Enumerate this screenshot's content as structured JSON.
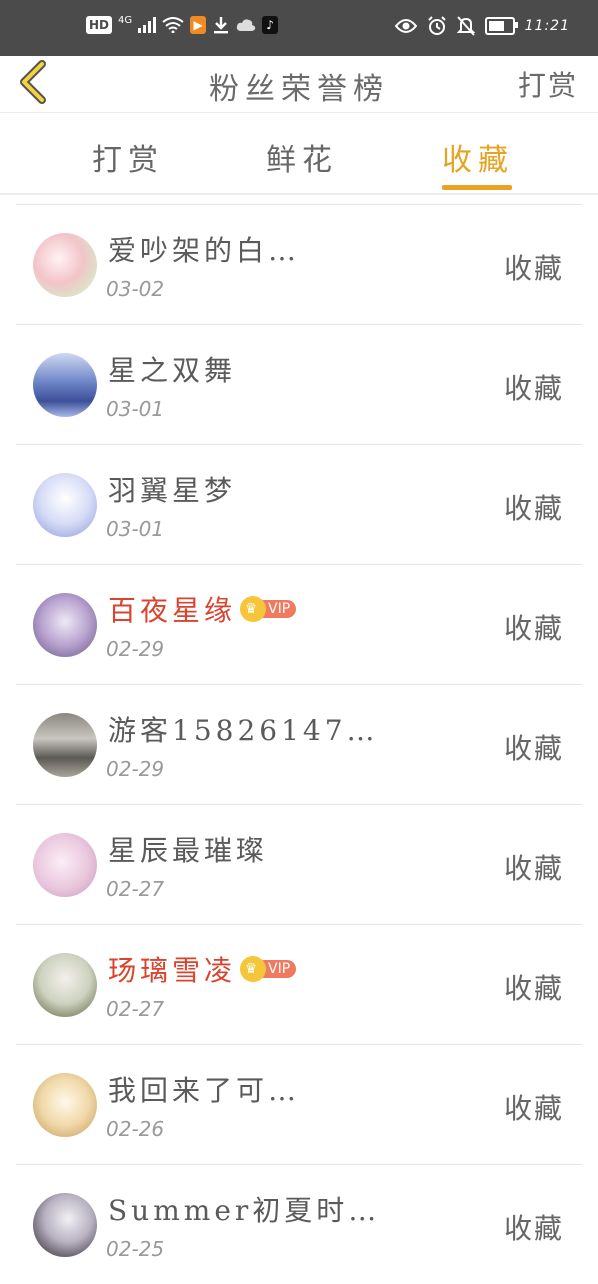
{
  "status_bar": {
    "hd": "HD",
    "network": "4G",
    "time": "11:21",
    "icons": [
      "hd-icon",
      "signal-icon",
      "wifi-icon",
      "video-app-icon",
      "download-icon",
      "cloud-icon",
      "tiktok-icon",
      "eye-icon",
      "alarm-icon",
      "bell-off-icon",
      "battery-icon"
    ]
  },
  "header": {
    "title": "粉丝荣誉榜",
    "right_link": "打赏"
  },
  "tabs": [
    {
      "label": "打赏",
      "active": false
    },
    {
      "label": "鲜花",
      "active": false
    },
    {
      "label": "收藏",
      "active": true
    }
  ],
  "colors": {
    "accent": "#e8a224",
    "vip_name": "#d9442e",
    "status_bar": "#4b4b4b"
  },
  "rows": [
    {
      "name": "爱吵架的白…",
      "date": "03-02",
      "action": "收藏",
      "vip": false
    },
    {
      "name": "星之双舞",
      "date": "03-01",
      "action": "收藏",
      "vip": false
    },
    {
      "name": "羽翼星梦",
      "date": "03-01",
      "action": "收藏",
      "vip": false
    },
    {
      "name": "百夜星缘",
      "date": "02-29",
      "action": "收藏",
      "vip": true,
      "badge": "VIP"
    },
    {
      "name": "游客15826147…",
      "date": "02-29",
      "action": "收藏",
      "vip": false
    },
    {
      "name": "星辰最璀璨",
      "date": "02-27",
      "action": "收藏",
      "vip": false
    },
    {
      "name": "玚璃雪凌",
      "date": "02-27",
      "action": "收藏",
      "vip": true,
      "badge": "VIP"
    },
    {
      "name": "我回来了可…",
      "date": "02-26",
      "action": "收藏",
      "vip": false
    },
    {
      "name": "Summer初夏时…",
      "date": "02-25",
      "action": "收藏",
      "vip": false
    }
  ]
}
